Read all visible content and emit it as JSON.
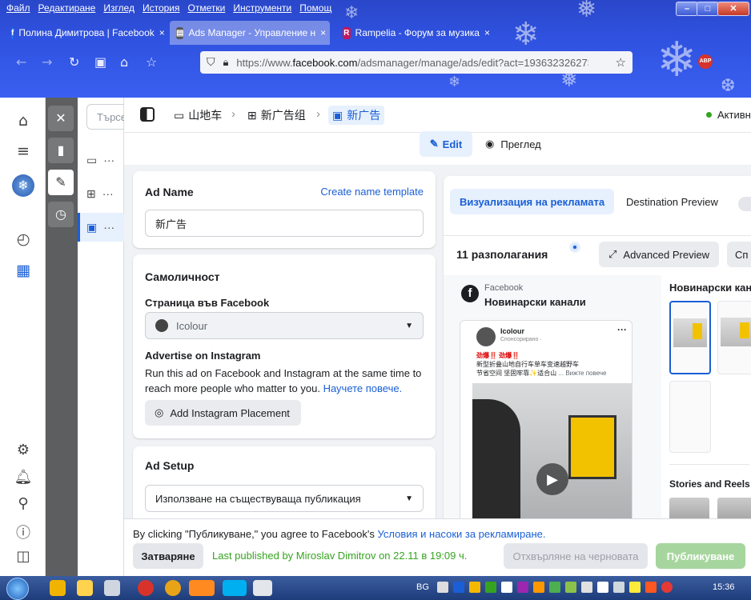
{
  "window": {
    "menu": [
      "Файл",
      "Редактиране",
      "Изглед",
      "История",
      "Отметки",
      "Инструменти",
      "Помощ"
    ],
    "tabs": [
      {
        "label": "Полина Димитрова | Facebook",
        "close": "×"
      },
      {
        "label": "Ads Manager - Управление н",
        "close": "×"
      },
      {
        "label": "Rampelia - Форум за музика",
        "close": "×"
      }
    ],
    "url_prefix": "https://www.",
    "url_domain": "facebook.com",
    "url_rest": "/adsmanager/manage/ads/edit?act=193632326273",
    "abp": "ABP"
  },
  "sidebar": {
    "search_placeholder": "Търсе"
  },
  "breadcrumb": {
    "campaign": "山地车",
    "adset": "新广告组",
    "ad": "新广告"
  },
  "status": {
    "label": "Активн"
  },
  "modes": {
    "edit": "Edit",
    "preview": "Преглед"
  },
  "ad_name": {
    "title": "Ad Name",
    "template_link": "Create name template",
    "value": "新广告"
  },
  "identity": {
    "title": "Самоличност",
    "page_label": "Страница във Facebook",
    "page_value": "Icolour",
    "ig_title": "Advertise on Instagram",
    "ig_text": "Run this ad on Facebook and Instagram at the same time to reach more people who matter to you.",
    "ig_link": "Научете повече.",
    "ig_button": "Add Instagram Placement"
  },
  "ad_setup": {
    "title": "Ad Setup",
    "select": "Използване на съществуваща публикация"
  },
  "preview": {
    "tab_active": "Визуализация на рекламата",
    "tab_dest": "Destination Preview",
    "placements": "11 разполагания",
    "advanced": "Advanced Preview",
    "cut_btn": "Сп",
    "source": "Facebook",
    "feed": "Новинарски канали",
    "right_title": "Новинарски кан",
    "stories": "Stories and Reels",
    "post_page": "Icolour",
    "post_sponsored": "Спонсорирано · ",
    "post_text_1": "劲爆‼️ 劲爆‼️",
    "post_text_2": "新型折叠山地自行车单车变速越野车",
    "post_text_3": "节省空间 坚固牢靠✨适合山",
    "post_more": "... Вижте повече"
  },
  "footer": {
    "agree_prefix": "By clicking \"Публикуване,\" you agree to Facebook's ",
    "agree_link": "Условия и насоки за рекламиране.",
    "close": "Затваряне",
    "published": "Last published by Miroslav Dimitrov on 22.11 в 19:09 ч.",
    "discard": "Отхвърляне на черновата",
    "publish": "Публикуване"
  },
  "taskbar": {
    "lang": "BG",
    "time": "15:36"
  }
}
